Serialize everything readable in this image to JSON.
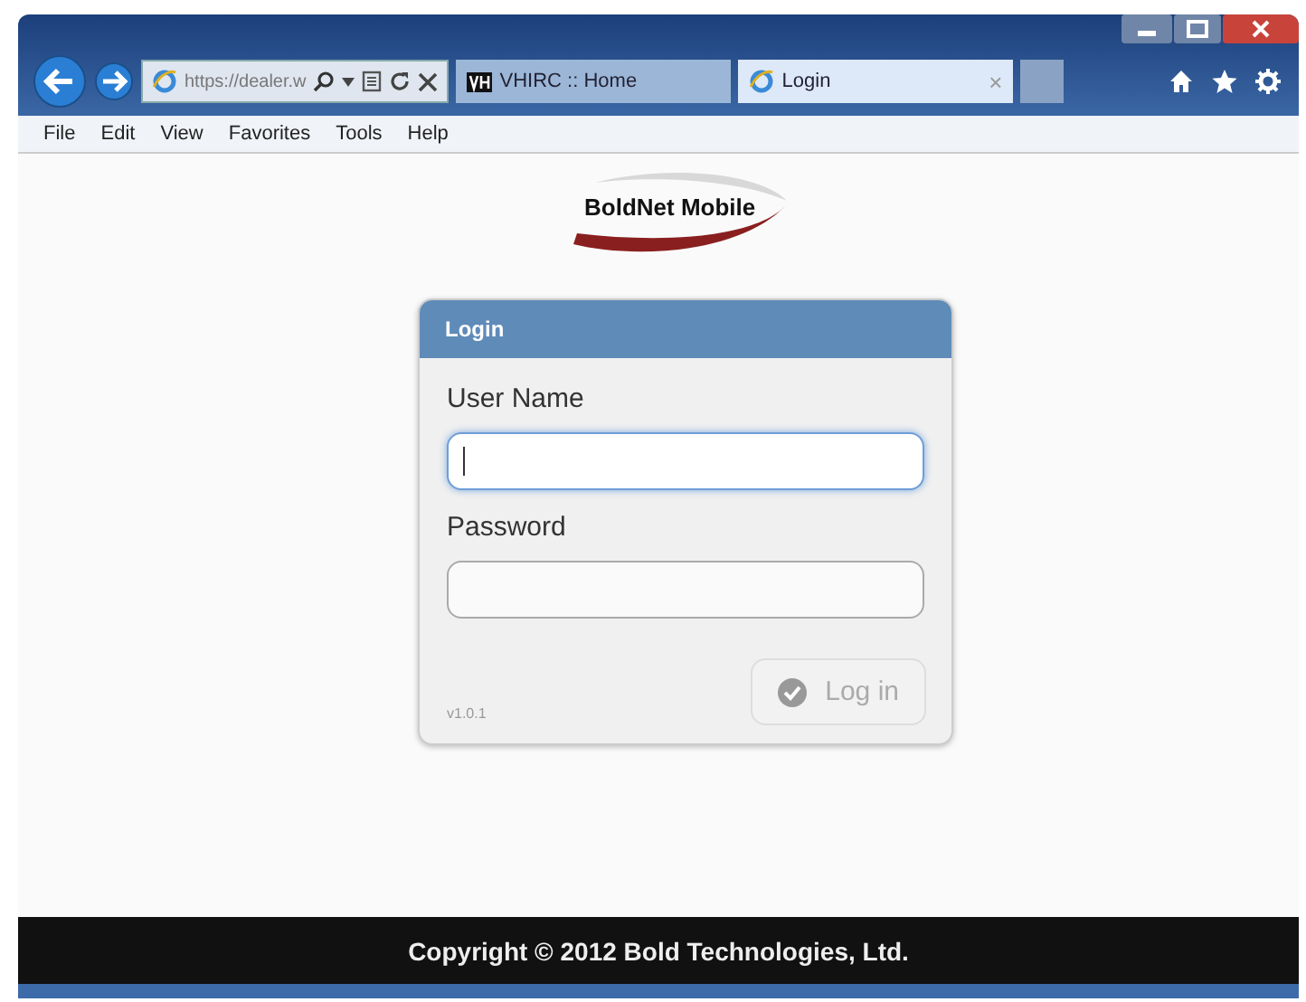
{
  "browser": {
    "address": "https://dealer.w",
    "tabs": [
      {
        "label": "VHIRC :: Home",
        "selected": false,
        "kind": "site"
      },
      {
        "label": "Login",
        "selected": true,
        "kind": "ie"
      }
    ],
    "tab_close": "×",
    "menu": [
      "File",
      "Edit",
      "View",
      "Favorites",
      "Tools",
      "Help"
    ]
  },
  "logo": {
    "text": "BoldNet Mobile"
  },
  "login_panel": {
    "title": "Login",
    "fields": [
      {
        "label": "User Name",
        "focused": true
      },
      {
        "label": "Password",
        "focused": false
      }
    ],
    "button": {
      "label": "Log in",
      "disabled": true
    },
    "version": "v1.0.1"
  },
  "footer": {
    "text": "Copyright © 2012 Bold Technologies, Ltd."
  }
}
